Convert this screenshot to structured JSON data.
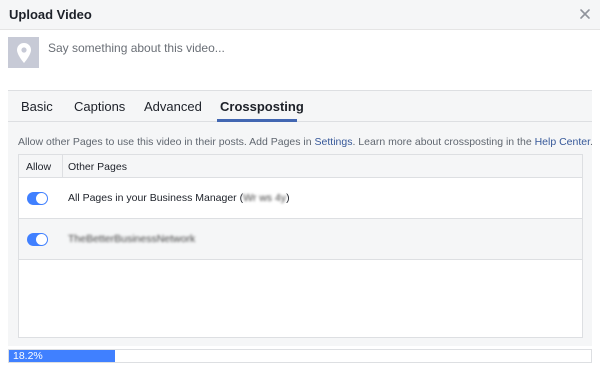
{
  "dialog": {
    "title": "Upload Video",
    "close_icon": "close-icon"
  },
  "composer": {
    "thumbnail_icon": "map-pin-icon",
    "placeholder": "Say something about this video..."
  },
  "tabs": [
    {
      "label": "Basic",
      "active": false
    },
    {
      "label": "Captions",
      "active": false
    },
    {
      "label": "Advanced",
      "active": false
    },
    {
      "label": "Crossposting",
      "active": true
    }
  ],
  "crossposting": {
    "info_prefix": "Allow other Pages to use this video in their posts. Add Pages in ",
    "settings_link": "Settings",
    "info_middle": ". Learn more about crossposting in the ",
    "help_link": "Help Center",
    "info_suffix": ".",
    "table": {
      "headers": {
        "allow": "Allow",
        "pages": "Other Pages"
      },
      "rows": [
        {
          "allowed": true,
          "label": "All Pages in your Business Manager (",
          "label_redacted": "Wr  ws  4y",
          "label_end": ")"
        },
        {
          "allowed": true,
          "label": "",
          "label_redacted": "TheBetterBusinessNetwork",
          "label_end": ""
        }
      ]
    }
  },
  "upload": {
    "progress": 0.182,
    "progress_label": "18.2%"
  },
  "colors": {
    "accent": "#4267b2",
    "toggle_on": "#4080ff",
    "link": "#365899"
  }
}
